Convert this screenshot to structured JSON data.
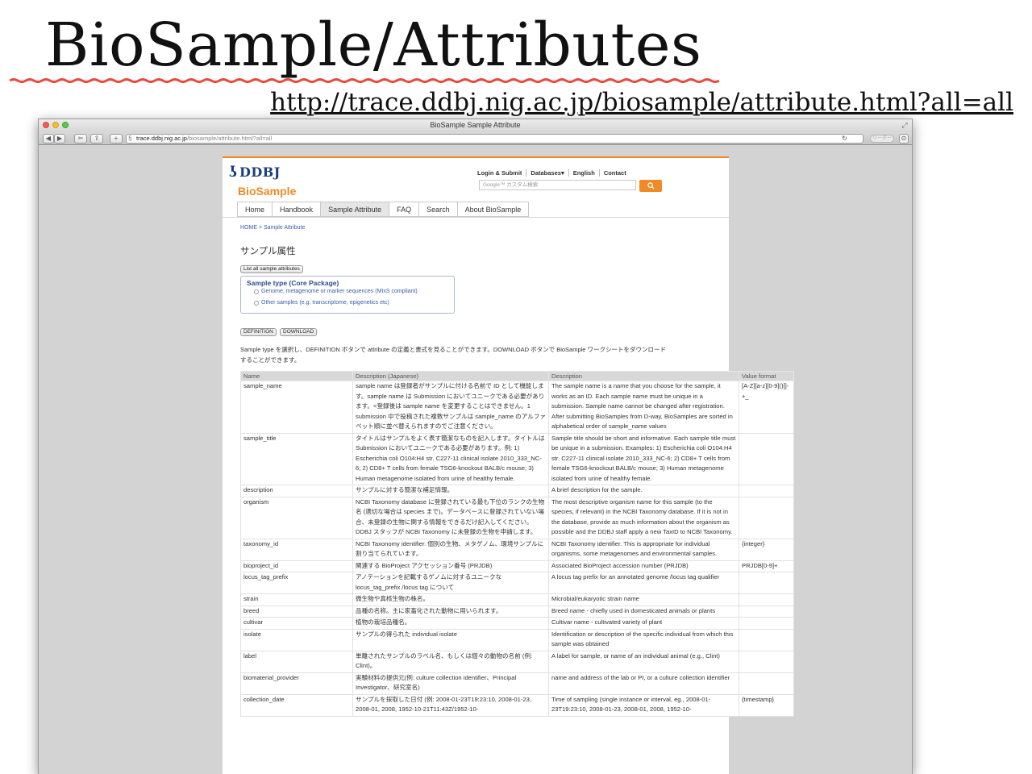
{
  "slide": {
    "title": "BioSample/Attributes",
    "url": "http://trace.ddbj.nig.ac.jp/biosample/attribute.html?all=all"
  },
  "browser": {
    "window_title": "BioSample Sample Attribute",
    "address_host": "trace.ddbj.nig.ac.jp",
    "address_path": "/biosample/attribute.html?all=all",
    "reader_label": "リーダー"
  },
  "site": {
    "logo_text": "DDBJ",
    "brand": "BioSample",
    "top_links": [
      "Login & Submit",
      "Databases▾",
      "English",
      "Contact"
    ],
    "search_placeholder": "Google™ カスタム検索",
    "tabs": [
      "Home",
      "Handbook",
      "Sample Attribute",
      "FAQ",
      "Search",
      "About BioSample"
    ],
    "active_tab": "Sample Attribute",
    "breadcrumb": "HOME > Sample Attribute",
    "section_heading": "サンプル属性",
    "list_all_button": "List all sample attributes",
    "sample_type_legend": "Sample type (Core Package)",
    "sample_type_options": [
      "Genome, metagenome or marker sequences (MIxS compliant)",
      "Other samples (e.g. transcriptome, epigenetics etc)"
    ],
    "definition_button": "DEFINITION",
    "download_button": "DOWNLOAD",
    "help_text": "Sample type を選択し、DEFINITION ボタンで attribute の定義と書式を見ることができます。DOWNLOAD ボタンで BioSample ワークシートをダウンロードすることができます。"
  },
  "table": {
    "headers": [
      "Name",
      "Description (Japanese)",
      "Description",
      "Value format"
    ],
    "rows": [
      [
        "sample_name",
        "sample name は登録者がサンプルに付ける名前で ID として機能します。sample name は Submission においてユニークである必要があります。<登録後は sample name を変更することはできません。1 submission 中で投稿された複数サンプルは sample_name のアルファベット順に並べ替えられますのでご注意ください。",
        "The sample name is a name that you choose for the sample, it works as an ID. Each sample name must be unique in a submission. Sample name cannot be changed after registration. After submitting BioSamples from D-way, BioSamples are sorted in alphabetical order of sample_name values",
        "[A-Z][a-z][0-9]()[]-+_"
      ],
      [
        "sample_title",
        "タイトルはサンプルをよく表す簡潔なものを記入します。タイトルは Submission においてユニークである必要があります。例: 1) Escherichia coli O104:H4 str. C227-11 clinical isolate 2010_333_NC-6; 2) CD8+ T cells from female TSG6-knockout BALB/c mouse; 3) Human metagenome isolated from urine of healthy female.",
        "Sample title should be short and informative. Each sample title must be unique in a submission. Examples: 1) Escherichia coli O104:H4 str. C227-11 clinical isolate 2010_333_NC-6; 2) CD8+ T cells from female TSG6-knockout BALB/c mouse; 3) Human metagenome isolated from urine of healthy female.",
        ""
      ],
      [
        "description",
        "サンプルに対する簡潔な補足情報。",
        "A brief description for the sample.",
        ""
      ],
      [
        "organism",
        "NCBI Taxonomy database に登録されている最も下位のランクの生物名 (適切な場合は species まで)。データベースに登録されていない場合、未登録の生物に関する情報をできるだけ記入してください。DDBJ スタッフが NCBI Taxonomy に未登録の生物を申請します。",
        "The most descriptive organism name for this sample (to the species, if relevant) in the NCBI Taxonomy database. If it is not in the database, provide as much information about the organism as possible and the DDBJ staff apply a new TaxID to NCBI Taxonomy.",
        ""
      ],
      [
        "taxonomy_id",
        "NCBI Taxonomy identifier. 個別の生物、メタゲノム、環境サンプルに割り当てられています。",
        "NCBI Taxonomy identifier. This is appropriate for individual organisms, some metagenomes and environmental samples.",
        "{integer}"
      ],
      [
        "bioproject_id",
        "関連する BioProject アクセッション番号 (PRJDB)",
        "Associated BioProject accession number (PRJDB)",
        "PRJDB[0-9]+"
      ],
      [
        "locus_tag_prefix",
        "アノテーションを記載するゲノムに対するユニークな locus_tag_prefix /locus tag について",
        "A locus tag prefix for an annotated genome /locus tag qualifier",
        ""
      ],
      [
        "strain",
        "微生物や真核生物の株名。",
        "Microbial/eukaryotic strain name",
        ""
      ],
      [
        "breed",
        "品種の名称。主に家畜化された動物に用いられます。",
        "Breed name - chiefly used in domesticated animals or plants",
        ""
      ],
      [
        "cultivar",
        "植物の栽培品種名。",
        "Cultivar name - cultivated variety of plant",
        ""
      ],
      [
        "isolate",
        "サンプルの得られた individual isolate",
        "Identification or description of the specific individual from which this sample was obtained",
        ""
      ],
      [
        "label",
        "単離されたサンプルのラベル名、もしくは個々の動物の名前 (例: Clint)。",
        "A label for sample, or name of an individual animal (e.g., Clint)",
        ""
      ],
      [
        "biomaterial_provider",
        "実験材料の提供元(例: culture collection identifier、Principal Investigator、研究室名)",
        "name and address of the lab or PI, or a culture collection identifier",
        ""
      ],
      [
        "collection_date",
        "サンプルを採取した日付 (例: 2008-01-23T19:23:10, 2008-01-23, 2008-01, 2008, 1952-10-21T11:43Z/1952-10-",
        "Time of sampling (single instance or interval, eg., 2008-01-23T19:23:10, 2008-01-23, 2008-01, 2008, 1952-10-",
        "{timestamp}"
      ]
    ]
  },
  "colors": {
    "accent_orange": "#f08a24",
    "link_blue": "#3a5fa8",
    "highlight_red": "#e0301e",
    "underline_red": "#e8493f"
  }
}
